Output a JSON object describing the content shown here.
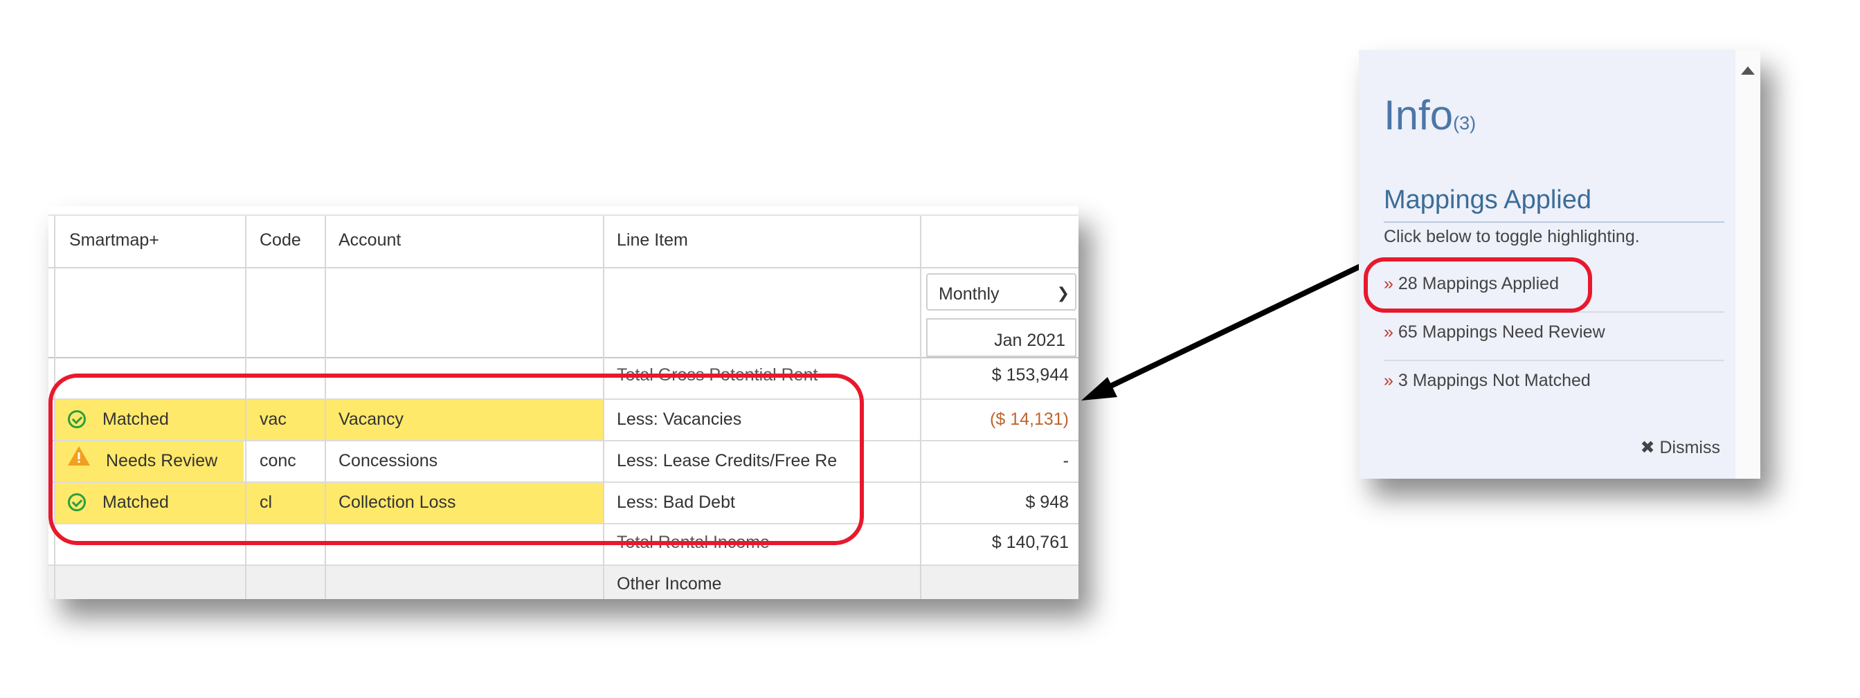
{
  "table": {
    "headers": {
      "smartmap": "Smartmap+",
      "code": "Code",
      "account": "Account",
      "line_item": "Line Item"
    },
    "period_select": "Monthly",
    "period_date": "Jan 2021",
    "rows": [
      {
        "status": "",
        "code": "",
        "account": "",
        "line_item": "Total Gross Potential Rent",
        "amount": "$ 153,944"
      },
      {
        "status": "Matched",
        "code": "vac",
        "account": "Vacancy",
        "line_item": "Less: Vacancies",
        "amount": "($ 14,131)"
      },
      {
        "status": "Needs Review",
        "code": "conc",
        "account": "Concessions",
        "line_item": "Less: Lease Credits/Free Re",
        "amount": "-"
      },
      {
        "status": "Matched",
        "code": "cl",
        "account": "Collection Loss",
        "line_item": "Less: Bad Debt",
        "amount": "$ 948"
      },
      {
        "status": "",
        "code": "",
        "account": "",
        "line_item": "Total Rental Income",
        "amount": "$ 140,761"
      },
      {
        "status": "",
        "code": "",
        "account": "",
        "line_item": "Other Income",
        "amount": ""
      }
    ]
  },
  "info": {
    "title": "Info",
    "count": "(3)",
    "section_title": "Mappings Applied",
    "hint": "Click below to toggle highlighting.",
    "links": [
      {
        "chev": "»",
        "label": "28 Mappings Applied"
      },
      {
        "chev": "»",
        "label": "65 Mappings Need Review"
      },
      {
        "chev": "»",
        "label": "3 Mappings Not Matched"
      }
    ],
    "dismiss": "Dismiss"
  },
  "colors": {
    "highlight": "#ffe96a",
    "annotation": "#e8192c",
    "negative": "#c0642b",
    "accent": "#4a77a6"
  },
  "icons": [
    "check-circle-icon",
    "warning-icon",
    "close-icon",
    "chevron-down-icon",
    "scroll-up-icon"
  ]
}
